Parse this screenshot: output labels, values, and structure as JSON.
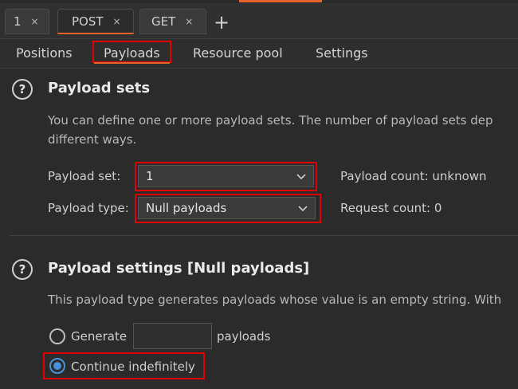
{
  "tabs": [
    {
      "label": "1",
      "close": "×"
    },
    {
      "label": "POST",
      "close": "×"
    },
    {
      "label": "GET",
      "close": "×"
    }
  ],
  "add_tab": "+",
  "subtabs": [
    "Positions",
    "Payloads",
    "Resource pool",
    "Settings"
  ],
  "payload_sets": {
    "title": "Payload sets",
    "description_line1": "You can define one or more payload sets. The number of payload sets dep",
    "description_line2": "different ways.",
    "set_label": "Payload set:",
    "set_value": "1",
    "type_label": "Payload type:",
    "type_value": "Null payloads",
    "payload_count": "Payload count: unknown",
    "request_count": "Request count: 0"
  },
  "payload_settings": {
    "title": "Payload settings [Null payloads]",
    "description": "This payload type generates payloads whose value is an empty string. With",
    "generate_label": "Generate",
    "generate_value": "",
    "payloads_suffix": "payloads",
    "continue_label": "Continue indefinitely"
  },
  "colors": {
    "accent": "#e8632b",
    "highlight": "#e00000",
    "radio_selected": "#4a90d9"
  }
}
